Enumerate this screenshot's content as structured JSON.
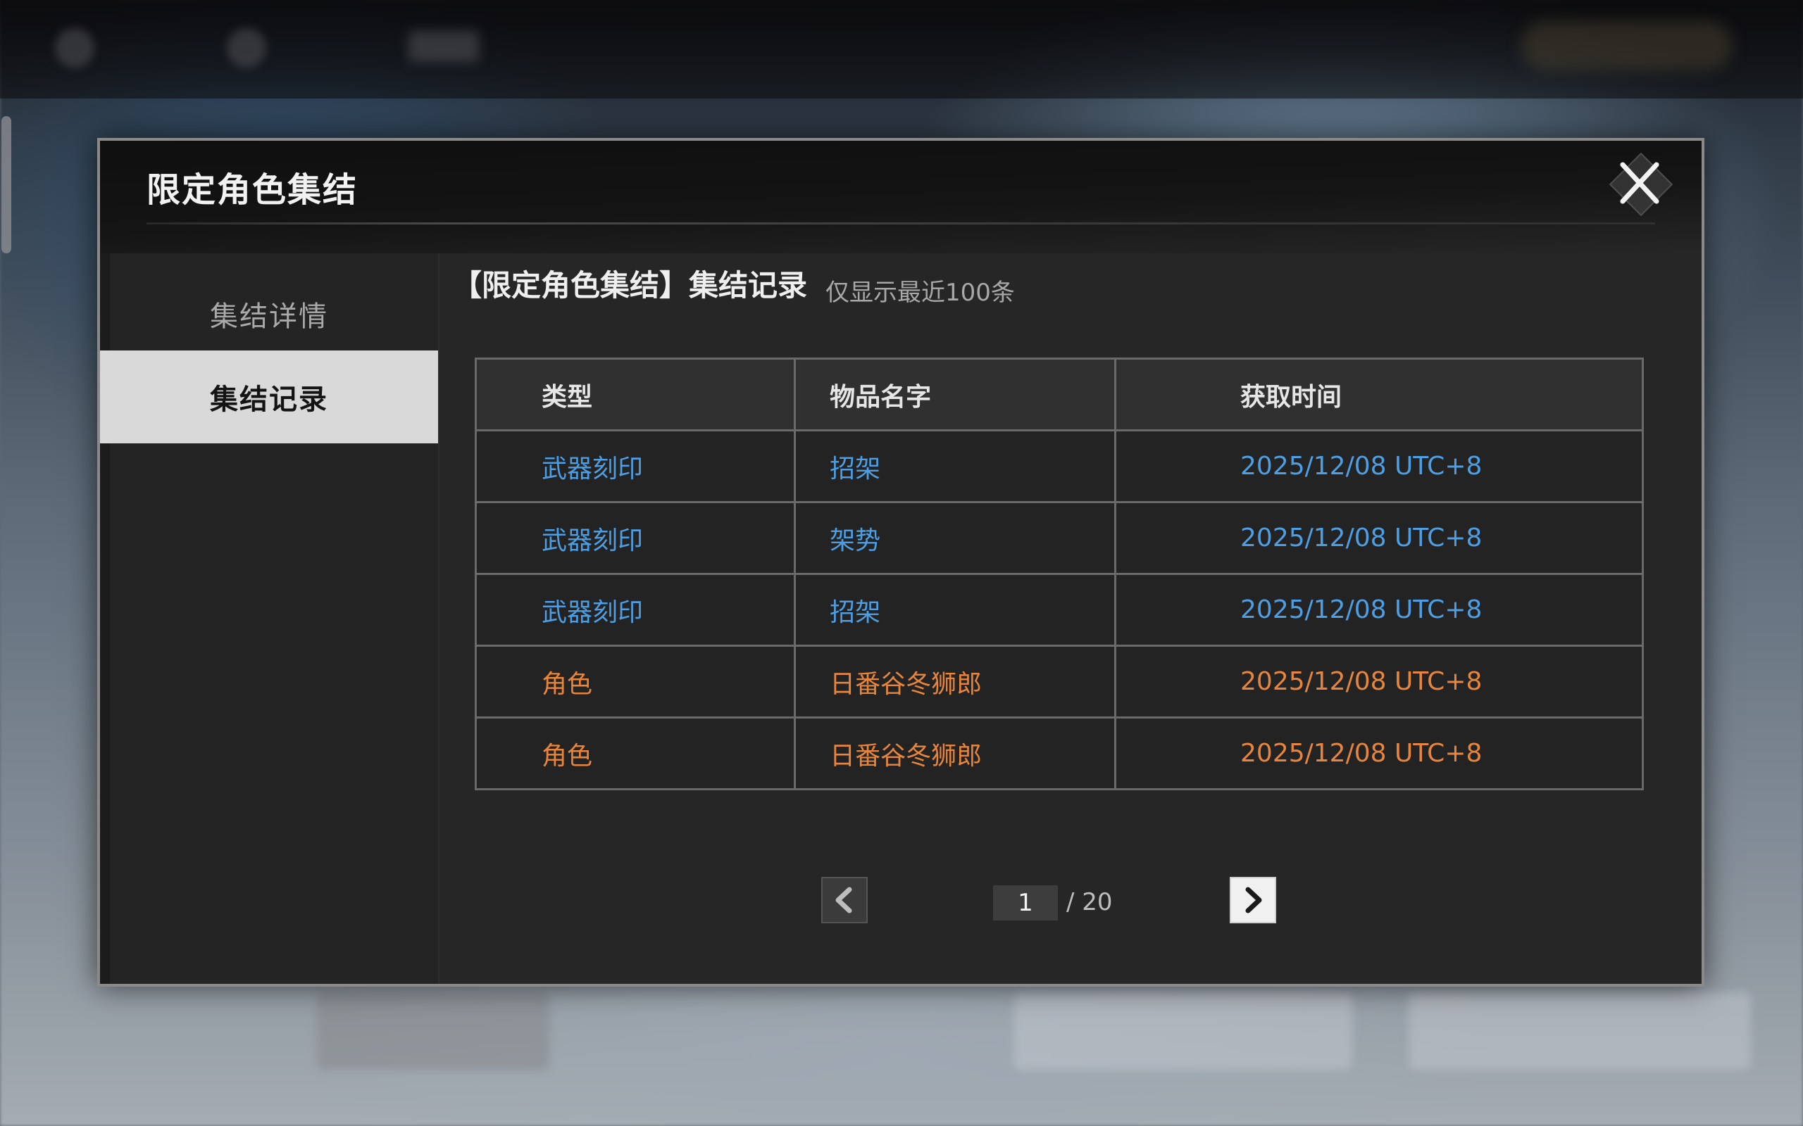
{
  "dialog": {
    "title": "限定角色集结"
  },
  "sidebar": {
    "items": [
      {
        "label": "集结详情",
        "active": false
      },
      {
        "label": "集结记录",
        "active": true
      }
    ]
  },
  "content": {
    "title": "【限定角色集结】集结记录",
    "subtitle": "仅显示最近100条"
  },
  "table": {
    "headers": [
      "类型",
      "物品名字",
      "获取时间"
    ],
    "rows": [
      {
        "type": "武器刻印",
        "name": "招架",
        "time": "2025/12/08 UTC+8",
        "color": "#4d9ee3"
      },
      {
        "type": "武器刻印",
        "name": "架势",
        "time": "2025/12/08 UTC+8",
        "color": "#4d9ee3"
      },
      {
        "type": "武器刻印",
        "name": "招架",
        "time": "2025/12/08 UTC+8",
        "color": "#4d9ee3"
      },
      {
        "type": "角色",
        "name": "日番谷冬狮郎",
        "time": "2025/12/08 UTC+8",
        "color": "#e8853d"
      },
      {
        "type": "角色",
        "name": "日番谷冬狮郎",
        "time": "2025/12/08 UTC+8",
        "color": "#e8853d"
      }
    ]
  },
  "pagination": {
    "current": "1",
    "total_label": "/ 20"
  },
  "icons": {
    "close": "close-icon",
    "prev": "chevron-left-icon",
    "next": "chevron-right-icon"
  },
  "colors": {
    "blue_item": "#4d9ee3",
    "orange_item": "#e8853d",
    "active_tab": "#d9d9d9"
  }
}
